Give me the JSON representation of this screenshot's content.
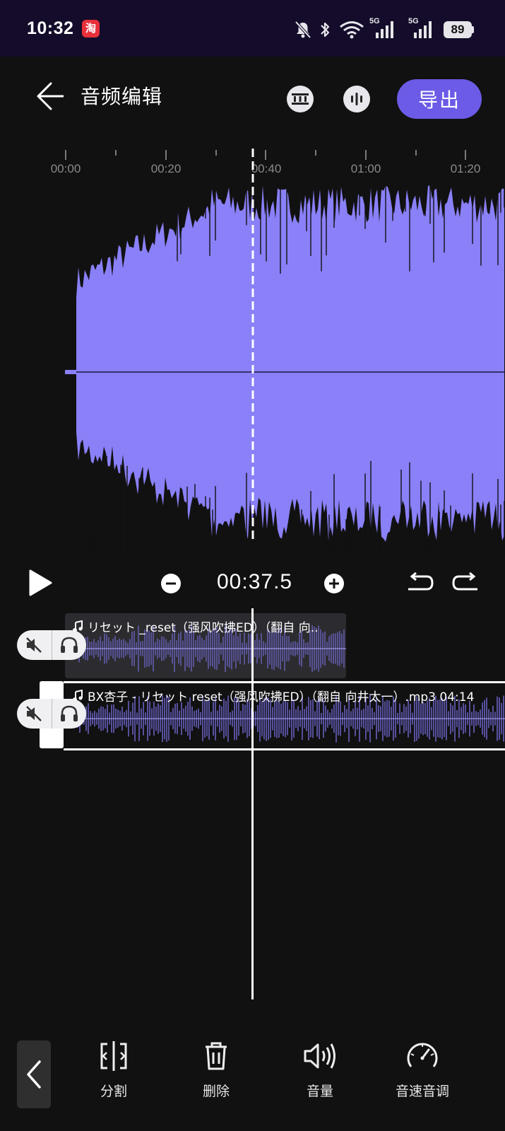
{
  "status_bar": {
    "time": "10:32",
    "app_icon_char": "淘",
    "network_1": "5G",
    "network_2": "5G",
    "battery": "89",
    "icons": [
      "mute-bell-icon",
      "bluetooth-icon",
      "wifi-icon",
      "signal-icon",
      "signal-icon",
      "battery-icon"
    ]
  },
  "header": {
    "title": "音频编辑",
    "export_label": "导出",
    "icons": [
      "back-arrow-icon",
      "film-strip-icon",
      "waveform-icon"
    ]
  },
  "ruler": {
    "labels": [
      "00:00",
      "00:20",
      "00:40",
      "01:00",
      "01:20"
    ]
  },
  "playback": {
    "current_time": "00:37.5",
    "icons": [
      "play-icon",
      "zoom-out-icon",
      "zoom-in-icon",
      "undo-icon",
      "redo-icon"
    ]
  },
  "tracks": [
    {
      "title": "リセット _reset（强风吹拂ED）（翻自 向..",
      "selected": false
    },
    {
      "title": "BX杏子 - リセット  reset（强风吹拂ED）（翻自 向井太一）.mp3  04:14",
      "selected": true
    }
  ],
  "toolbar": {
    "items": [
      {
        "label": "分割",
        "icon": "split-icon"
      },
      {
        "label": "删除",
        "icon": "trash-icon"
      },
      {
        "label": "音量",
        "icon": "volume-icon"
      },
      {
        "label": "音速音调",
        "icon": "speedometer-icon"
      }
    ]
  },
  "colors": {
    "accent": "#6b5be6",
    "waveform": "#8a80f8",
    "background": "#111111",
    "status_bar": "#140c2a"
  }
}
